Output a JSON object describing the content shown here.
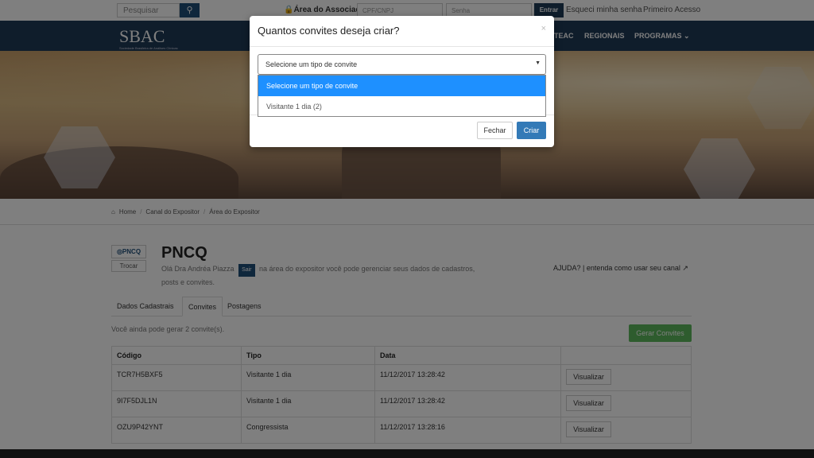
{
  "topbar": {
    "search_placeholder": "Pesquisar",
    "search_icon": "search-icon",
    "assoc_label": "🔒Área do Associado",
    "cpf_placeholder": "CPF/CNPJ",
    "senha_placeholder": "Senha",
    "entrar_label": "Entrar",
    "forgot_label": "Esqueci minha senha",
    "first_access_label": "Primeiro Acesso"
  },
  "nav": {
    "logo": "SBAC",
    "logo_sub": "Sociedade Brasileira de Análises Clínicas",
    "items": [
      "TEAC",
      "REGIONAIS",
      "PROGRAMAS ⌄"
    ]
  },
  "breadcrumb": [
    "Home",
    "Canal do Expositor",
    "Área do Expositor"
  ],
  "profile": {
    "logo_text": "◎PNCQ",
    "trocar_label": "Trocar",
    "company": "PNCQ",
    "welcome_pre": "Olá Dra Andréa Piazza",
    "sair_label": "Sair",
    "welcome_post": "na área do expositor você pode gerenciar seus dados de cadastros, posts e convites.",
    "help": "AJUDA? | entenda como usar seu canal ↗"
  },
  "tabs": [
    "Dados Cadastrais",
    "Convites",
    "Postagens"
  ],
  "remaining": "Você ainda pode gerar 2 convite(s).",
  "gerar_label": "Gerar Convites",
  "table": {
    "headers": [
      "Código",
      "Tipo",
      "Data",
      ""
    ],
    "rows": [
      [
        "TCR7H5BXF5",
        "Visitante 1 dia",
        "11/12/2017 13:28:42",
        "Visualizar"
      ],
      [
        "9I7F5DJL1N",
        "Visitante 1 dia",
        "11/12/2017 13:28:42",
        "Visualizar"
      ],
      [
        "OZU9P42YNT",
        "Congressista",
        "11/12/2017 13:28:16",
        "Visualizar"
      ]
    ]
  },
  "modal": {
    "title": "Quantos convites deseja criar?",
    "close": "×",
    "select_value": "Selecione um tipo de convite",
    "options": [
      "Selecione um tipo de convite",
      "Visitante 1 dia (2)"
    ],
    "fechar_label": "Fechar",
    "criar_label": "Criar"
  }
}
